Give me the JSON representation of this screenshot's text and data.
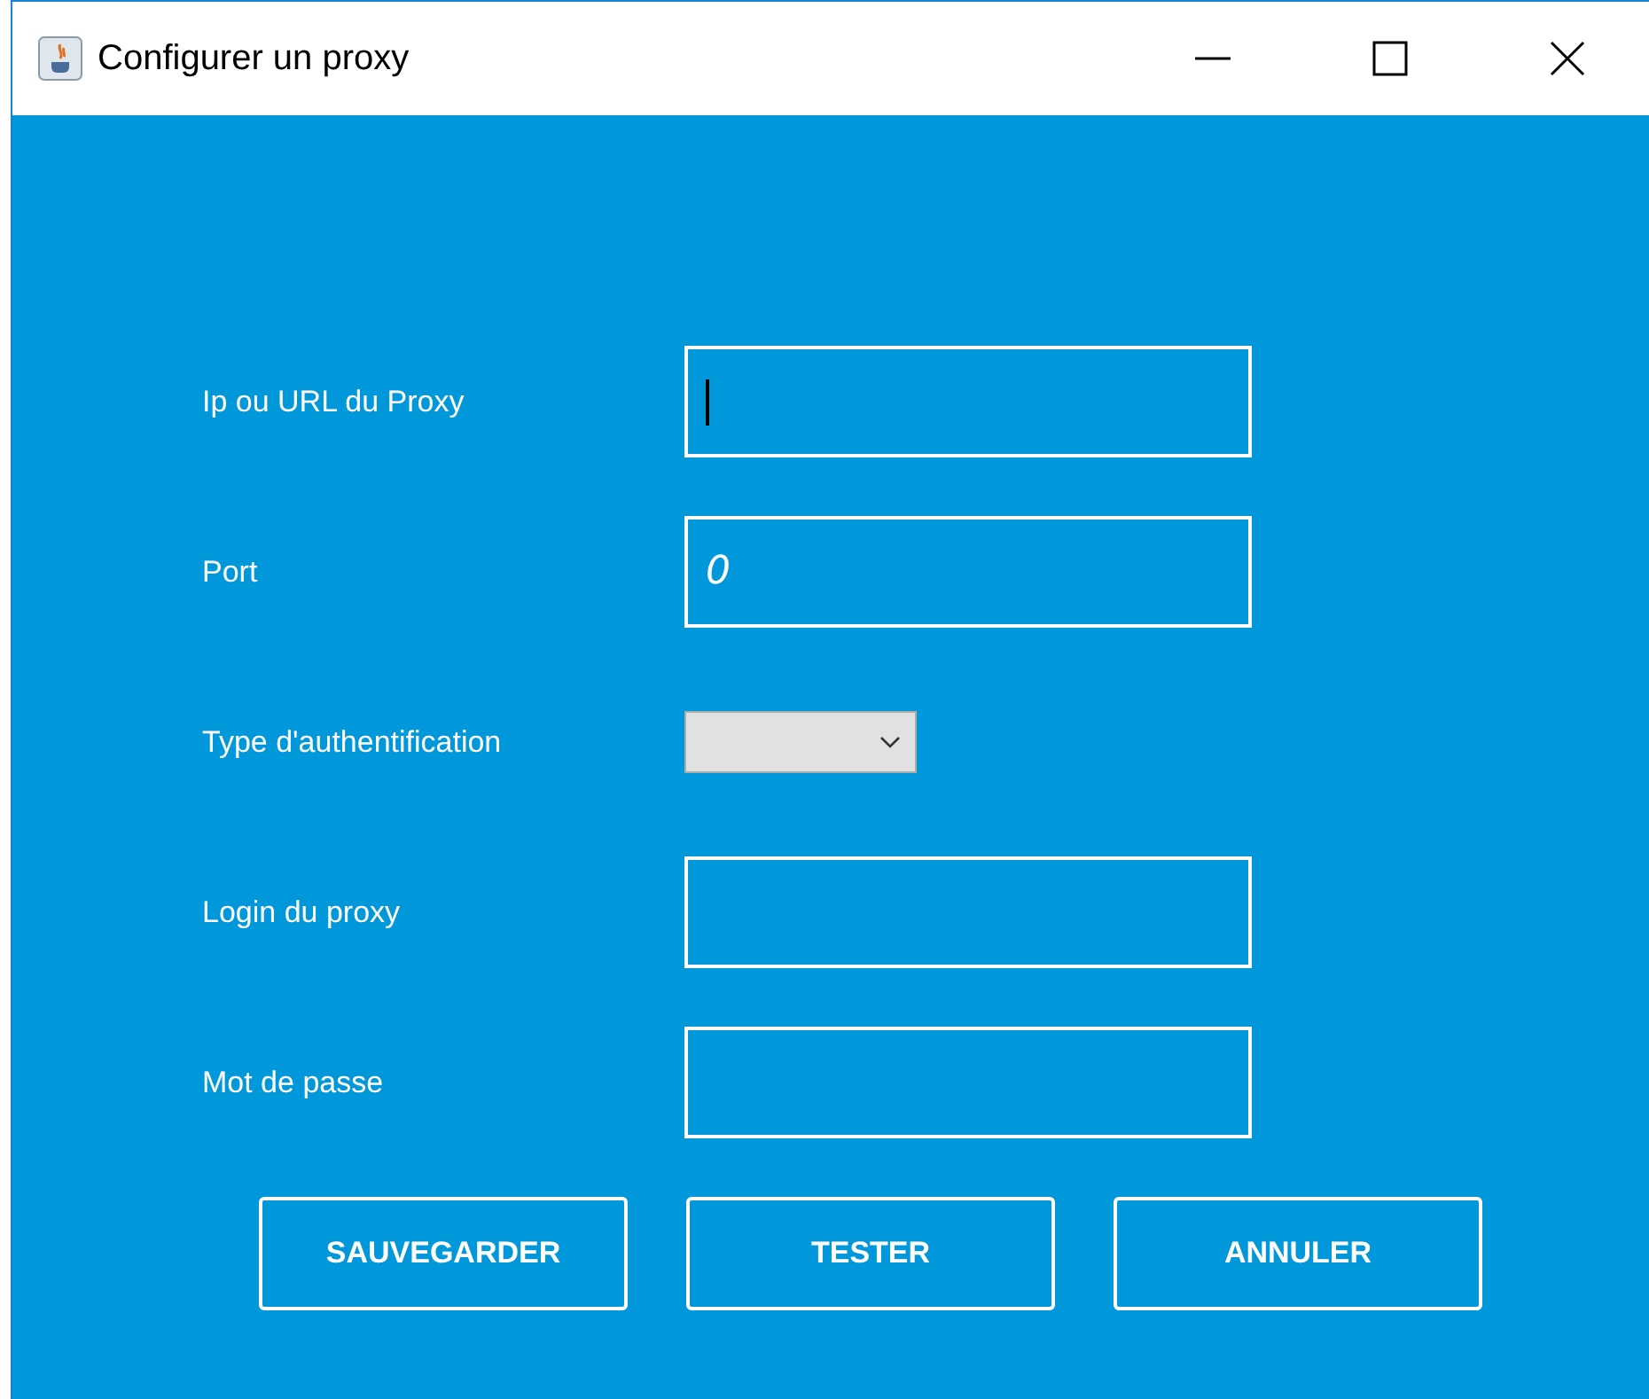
{
  "window": {
    "title": "Configurer un proxy"
  },
  "fields": [
    {
      "kind": "text",
      "label": "Ip ou URL du Proxy",
      "focused": true
    },
    {
      "kind": "text",
      "label": "Port",
      "value": "0"
    },
    {
      "kind": "combo",
      "label": "Type d'authentification"
    },
    {
      "kind": "text",
      "label": "Login du proxy"
    },
    {
      "kind": "text",
      "label": "Mot de passe"
    }
  ],
  "buttons": [
    "SAUVEGARDER",
    "TESTER",
    "ANNULER"
  ]
}
